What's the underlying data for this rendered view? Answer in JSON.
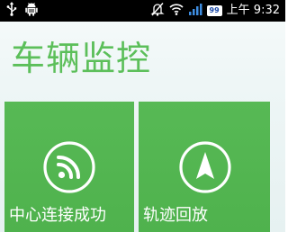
{
  "status_bar": {
    "icons_left": [
      "usb-icon",
      "android-debug-icon"
    ],
    "icons_right": [
      "silent-mode-icon",
      "wifi-icon",
      "signal-icon",
      "battery-icon"
    ],
    "battery_level": "99",
    "time": "上午 9:32"
  },
  "header": {
    "title": "车辆监控"
  },
  "tiles": [
    {
      "icon": "rss-feed-icon",
      "label": "中心连接成功"
    },
    {
      "icon": "navigation-arrow-icon",
      "label": "轨迹回放"
    }
  ],
  "colors": {
    "status_bar_bg": "#000000",
    "title_green": "#5cbf5a",
    "tile_green": "#53b651",
    "background": "#eef6f6"
  }
}
